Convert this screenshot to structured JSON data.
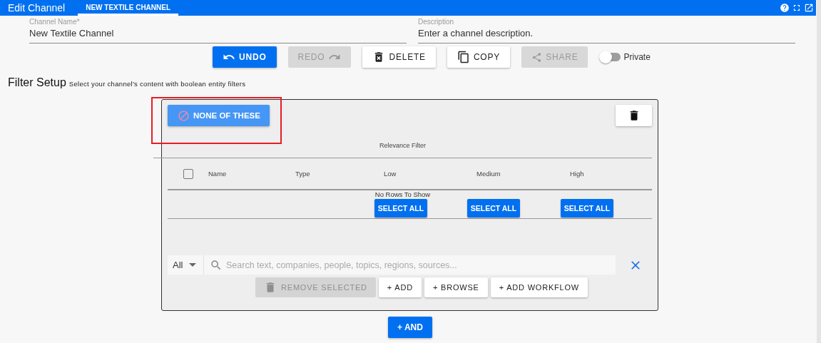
{
  "window": {
    "title": "Edit Channel"
  },
  "tabs": [
    {
      "label": "NEW TEXTILE CHANNEL",
      "selected": true
    }
  ],
  "fields": [
    {
      "label": "Channel Name*",
      "value": "New Textile Channel"
    },
    {
      "label": "Description",
      "placeholder": "Enter a channel description."
    }
  ],
  "toolbar": [
    {
      "kind": "undo",
      "label": "UNDO",
      "disabled": false
    },
    {
      "kind": "redo",
      "label": "REDO",
      "disabled": true
    },
    {
      "kind": "delete",
      "label": "DELETE",
      "disabled": false
    },
    {
      "kind": "copy",
      "label": "COPY",
      "disabled": false
    },
    {
      "kind": "share",
      "label": "SHARE",
      "disabled": true
    }
  ],
  "private_switch": {
    "label": "Private",
    "on": false
  },
  "filter_setup": {
    "title": "Filter Setup",
    "subtitle": "Select your channel's content with boolean entity filters"
  },
  "filter": {
    "mode_button": {
      "label": "NONE OF THESE",
      "highlighted": true
    },
    "group_heading": "Relevance Filter",
    "columns": [
      {
        "label": "Name"
      },
      {
        "label": "Type"
      },
      {
        "label": "Low",
        "select_all": "SELECT ALL"
      },
      {
        "label": "Medium",
        "select_all": "SELECT ALL"
      },
      {
        "label": "High",
        "select_all": "SELECT ALL"
      }
    ],
    "select_all_checked": false,
    "empty_message": "No Rows To Show",
    "scope": "All",
    "search_placeholder": "Search text, companies, people, topics, regions, sources...",
    "actions": [
      {
        "kind": "remove",
        "label": "REMOVE SELECTED",
        "disabled": true
      },
      {
        "kind": "text",
        "label": "+ ADD",
        "disabled": false
      },
      {
        "kind": "text",
        "label": "+ BROWSE",
        "disabled": false
      },
      {
        "kind": "text",
        "label": "+ ADD WORKFLOW",
        "disabled": false
      }
    ]
  },
  "and_button": "+ AND"
}
